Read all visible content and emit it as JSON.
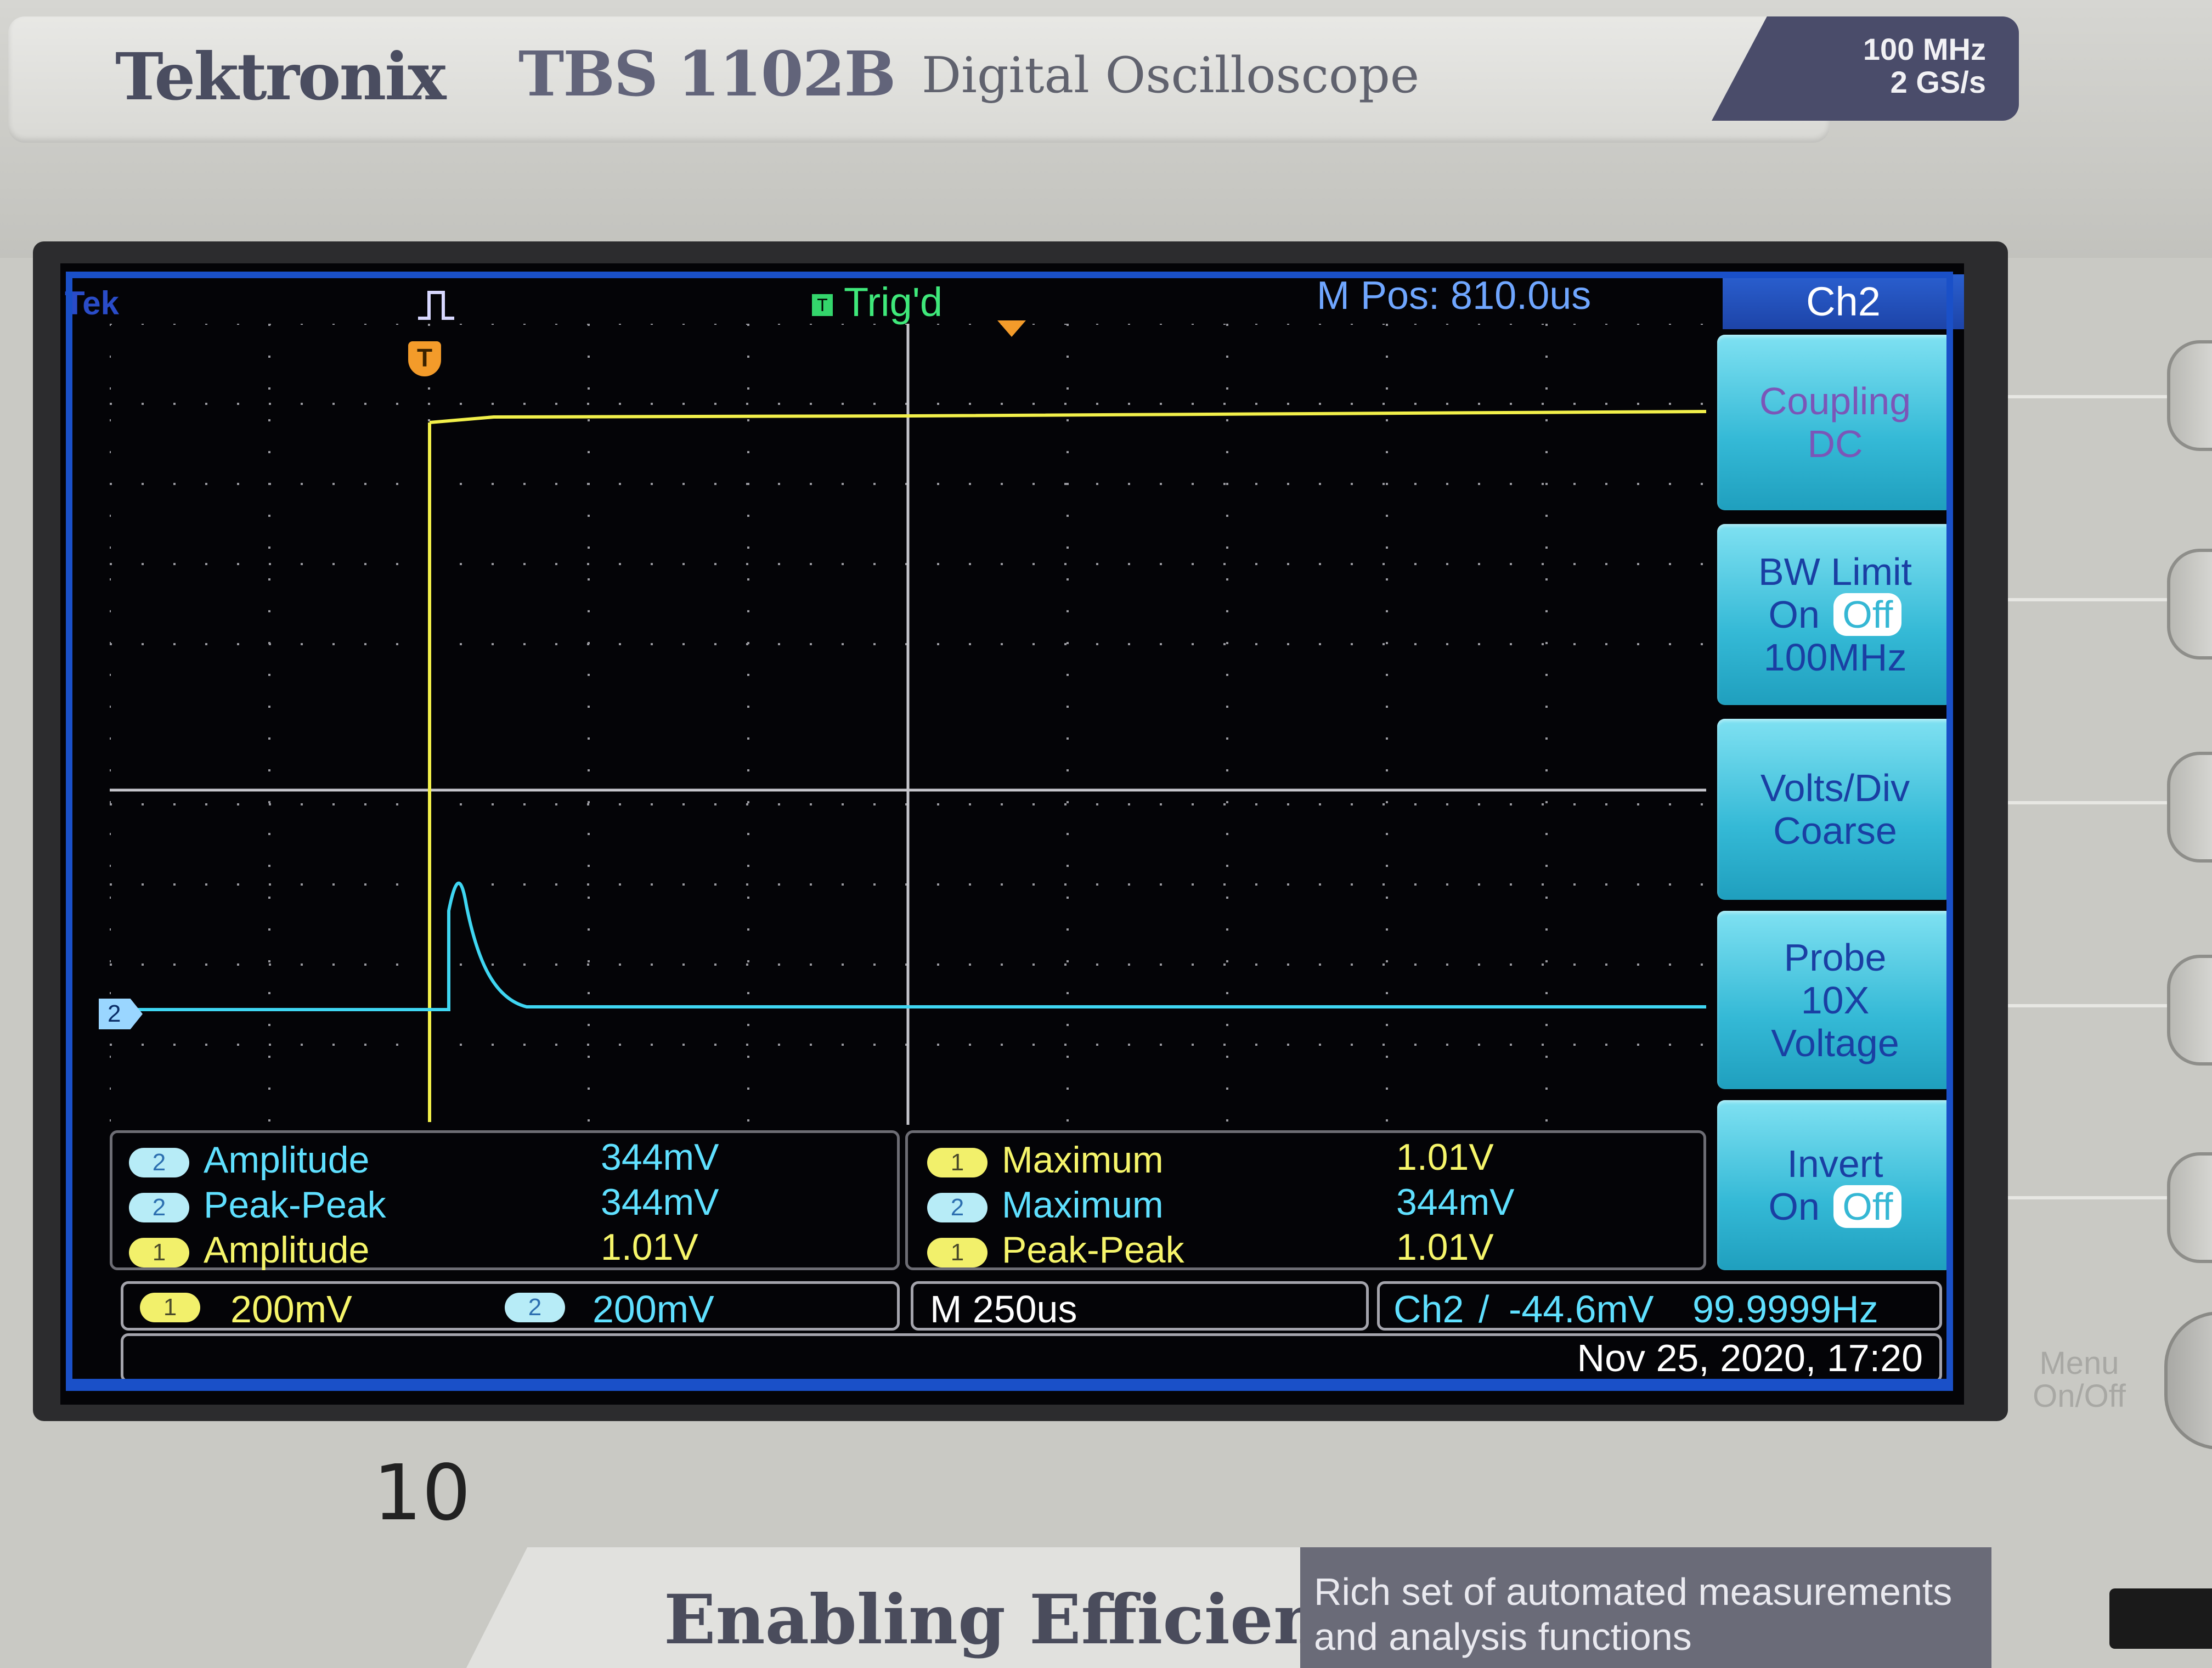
{
  "header": {
    "brand": "Tektronix",
    "model": "TBS 1102B",
    "product": "Digital Oscilloscope",
    "spec_bandwidth": "100 MHz",
    "spec_sample_rate": "2 GS/s"
  },
  "status_bar": {
    "tek_label": "Tek",
    "trigger_state": "Trig'd",
    "trigger_badge": "T",
    "horizontal_position": "M Pos: 810.0us"
  },
  "markers": {
    "trigger_marker": "T",
    "ch2_ground_marker": "2"
  },
  "side_menu": {
    "title": "Ch2",
    "coupling": {
      "line1": "Coupling",
      "line2": "DC"
    },
    "bw_limit": {
      "line1": "BW Limit",
      "on": "On",
      "off": "Off",
      "line3": "100MHz"
    },
    "volts_div": {
      "line1": "Volts/Div",
      "line2": "Coarse"
    },
    "probe": {
      "line1": "Probe",
      "line2": "10X",
      "line3": "Voltage"
    },
    "invert": {
      "line1": "Invert",
      "on": "On",
      "off": "Off"
    }
  },
  "measurements_left": [
    {
      "channel": "2",
      "label": "Amplitude",
      "value": "344mV"
    },
    {
      "channel": "2",
      "label": "Peak-Peak",
      "value": "344mV"
    },
    {
      "channel": "1",
      "label": "Amplitude",
      "value": "1.01V"
    }
  ],
  "measurements_right": [
    {
      "channel": "1",
      "label": "Maximum",
      "value": "1.01V"
    },
    {
      "channel": "2",
      "label": "Maximum",
      "value": "344mV"
    },
    {
      "channel": "1",
      "label": "Peak-Peak",
      "value": "1.01V"
    }
  ],
  "scale_bar": {
    "ch1_badge": "1",
    "ch1_scale": "200mV",
    "ch2_badge": "2",
    "ch2_scale": "200mV",
    "timebase": "M 250us",
    "trigger_source": "Ch2",
    "trigger_slope": "/",
    "trigger_level": "-44.6mV",
    "frequency": "99.9999Hz"
  },
  "datetime": "Nov 25, 2020, 17:20",
  "panel": {
    "menu_button": {
      "line1": "Menu",
      "line2": "On/Off"
    },
    "sticker_number": "10",
    "slogan": "Enabling Efficiency",
    "slogan_sub": "Rich set of automated measurements and analysis functions"
  },
  "colors": {
    "ch1_trace": "#f2f04a",
    "ch2_trace": "#3fd6f2",
    "menu_button": "#38bdd8",
    "menu_title": "#2151c0",
    "trigd_green": "#3fe87a"
  }
}
